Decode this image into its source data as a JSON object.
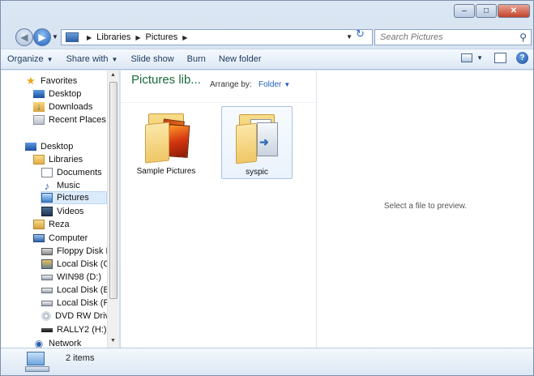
{
  "window": {
    "minimize_glyph": "–",
    "maximize_glyph": "□",
    "close_glyph": "✕"
  },
  "address": {
    "crumbs": [
      "Libraries",
      "Pictures"
    ],
    "search_placeholder": "Search Pictures"
  },
  "toolbar": {
    "organize": "Organize",
    "share_with": "Share with",
    "slide_show": "Slide show",
    "burn": "Burn",
    "new_folder": "New folder"
  },
  "nav": {
    "favorites": "Favorites",
    "desktop_fav": "Desktop",
    "downloads": "Downloads",
    "recent_places": "Recent Places",
    "desktop": "Desktop",
    "libraries": "Libraries",
    "documents": "Documents",
    "music": "Music",
    "pictures": "Pictures",
    "videos": "Videos",
    "user": "Reza",
    "computer": "Computer",
    "floppy": "Floppy Disk Dri",
    "local_c": "Local Disk (C:)",
    "win98": "WIN98 (D:)",
    "local_e": "Local Disk (E:)",
    "local_f": "Local Disk (F:)",
    "dvd": "DVD RW Drive (",
    "rally": "RALLY2 (H:)",
    "network": "Network"
  },
  "content": {
    "title": "Pictures lib...",
    "arrange_label": "Arrange by:",
    "arrange_value": "Folder",
    "files": [
      {
        "label": "Sample Pictures"
      },
      {
        "label": "syspic"
      }
    ]
  },
  "preview": {
    "message": "Select a file to preview."
  },
  "details": {
    "count": "2 items"
  }
}
